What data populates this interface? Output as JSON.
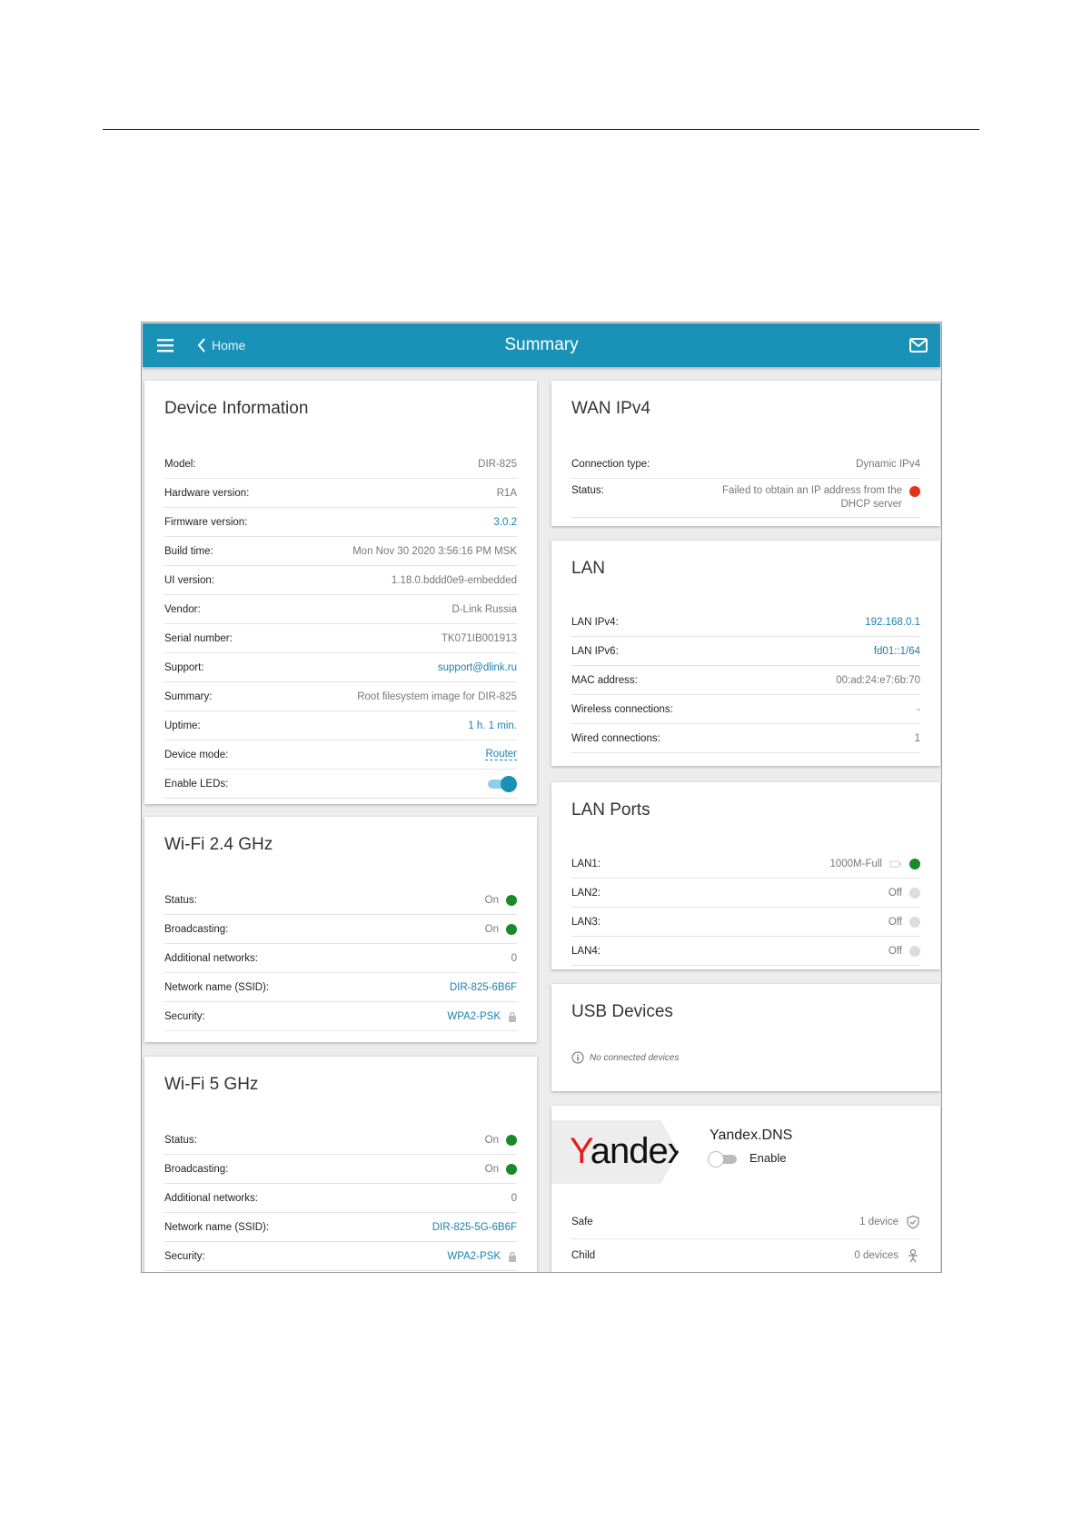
{
  "header": {
    "back_label": "Home",
    "title": "Summary"
  },
  "device_info": {
    "title": "Device Information",
    "rows": [
      {
        "label": "Model:",
        "value": "DIR-825"
      },
      {
        "label": "Hardware version:",
        "value": "R1A"
      },
      {
        "label": "Firmware version:",
        "value": "3.0.2"
      },
      {
        "label": "Build time:",
        "value": "Mon Nov 30 2020 3:56:16 PM MSK"
      },
      {
        "label": "UI version:",
        "value": "1.18.0.bddd0e9-embedded"
      },
      {
        "label": "Vendor:",
        "value": "D-Link Russia"
      },
      {
        "label": "Serial number:",
        "value": "TK071IB001913"
      },
      {
        "label": "Support:",
        "value": "support@dlink.ru"
      },
      {
        "label": "Summary:",
        "value": "Root filesystem image for DIR-825"
      },
      {
        "label": "Uptime:",
        "value": "1 h. 1 min."
      },
      {
        "label": "Device mode:",
        "value": "Router"
      },
      {
        "label": "Enable LEDs:",
        "value": ""
      }
    ]
  },
  "wifi24": {
    "title": "Wi-Fi 2.4 GHz",
    "rows": [
      {
        "label": "Status:",
        "value": "On"
      },
      {
        "label": "Broadcasting:",
        "value": "On"
      },
      {
        "label": "Additional networks:",
        "value": "0"
      },
      {
        "label": "Network name (SSID):",
        "value": "DIR-825-6B6F"
      },
      {
        "label": "Security:",
        "value": "WPA2-PSK"
      }
    ]
  },
  "wifi5": {
    "title": "Wi-Fi 5 GHz",
    "rows": [
      {
        "label": "Status:",
        "value": "On"
      },
      {
        "label": "Broadcasting:",
        "value": "On"
      },
      {
        "label": "Additional networks:",
        "value": "0"
      },
      {
        "label": "Network name (SSID):",
        "value": "DIR-825-5G-6B6F"
      },
      {
        "label": "Security:",
        "value": "WPA2-PSK"
      }
    ]
  },
  "wan": {
    "title": "WAN IPv4",
    "rows": [
      {
        "label": "Connection type:",
        "value": "Dynamic IPv4"
      },
      {
        "label": "Status:",
        "value": "Failed to obtain an IP address from the DHCP server"
      }
    ]
  },
  "lan": {
    "title": "LAN",
    "rows": [
      {
        "label": "LAN IPv4:",
        "value": "192.168.0.1"
      },
      {
        "label": "LAN IPv6:",
        "value": "fd01::1/64"
      },
      {
        "label": "MAC address:",
        "value": "00:ad:24:e7:6b:70"
      },
      {
        "label": "Wireless connections:",
        "value": "-"
      },
      {
        "label": "Wired connections:",
        "value": "1"
      }
    ]
  },
  "lan_ports": {
    "title": "LAN Ports",
    "rows": [
      {
        "label": "LAN1:",
        "value": "1000M-Full"
      },
      {
        "label": "LAN2:",
        "value": "Off"
      },
      {
        "label": "LAN3:",
        "value": "Off"
      },
      {
        "label": "LAN4:",
        "value": "Off"
      }
    ]
  },
  "usb": {
    "title": "USB Devices",
    "note": "No connected devices"
  },
  "yandex": {
    "logo_text_first": "Y",
    "logo_text_rest": "andex",
    "title": "Yandex.DNS",
    "enable_label": "Enable",
    "rows": [
      {
        "label": "Safe",
        "value": "1 device"
      },
      {
        "label": "Child",
        "value": "0 devices"
      }
    ]
  },
  "colors": {
    "topbar": "#1a92b8",
    "link": "#1a7fb0",
    "status_on": "#1a8a28",
    "status_error": "#e0321f"
  }
}
